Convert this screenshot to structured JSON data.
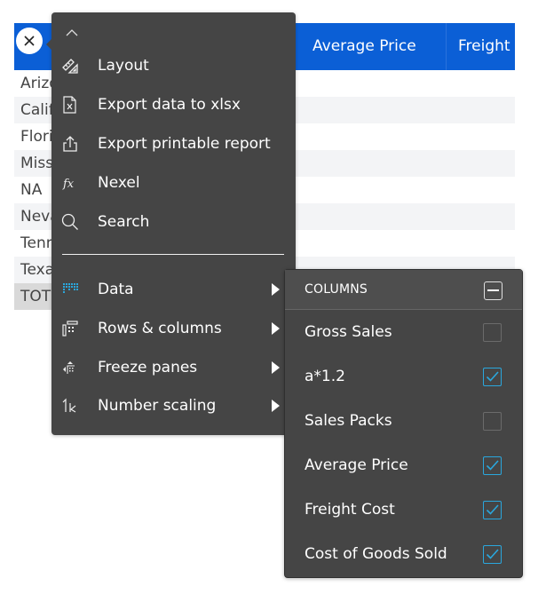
{
  "table": {
    "headers": [
      "Average Price",
      "Freight"
    ],
    "rows": [
      "Arizo",
      "Calif",
      "Flori",
      "Miss",
      "NA",
      "Neva",
      "Tenn",
      "Texa"
    ],
    "total_label": "TOT",
    "header_color": "#0b5fd6"
  },
  "menu": {
    "items": [
      {
        "label": "Layout",
        "icon": "ruler-triangle-icon"
      },
      {
        "label": "Export data to xlsx",
        "icon": "xlsx-file-icon"
      },
      {
        "label": "Export printable report",
        "icon": "share-upload-icon"
      },
      {
        "label": "Nexel",
        "icon": "fx-icon"
      },
      {
        "label": "Search",
        "icon": "search-icon"
      },
      {
        "label": "Data",
        "icon": "data-grid-icon",
        "submenu": true,
        "active": true
      },
      {
        "label": "Rows & columns",
        "icon": "rows-columns-icon",
        "submenu": true
      },
      {
        "label": "Freeze panes",
        "icon": "freeze-panes-icon",
        "submenu": true
      },
      {
        "label": "Number scaling",
        "icon": "number-scaling-icon",
        "submenu": true
      }
    ],
    "accent_color": "#2aa7dd"
  },
  "submenu": {
    "title": "COLUMNS",
    "columns": [
      {
        "label": "Gross Sales",
        "checked": false
      },
      {
        "label": "a*1.2",
        "checked": true
      },
      {
        "label": "Sales Packs",
        "checked": false
      },
      {
        "label": "Average Price",
        "checked": true
      },
      {
        "label": "Freight Cost",
        "checked": true
      },
      {
        "label": "Cost of Goods Sold",
        "checked": true
      }
    ]
  }
}
